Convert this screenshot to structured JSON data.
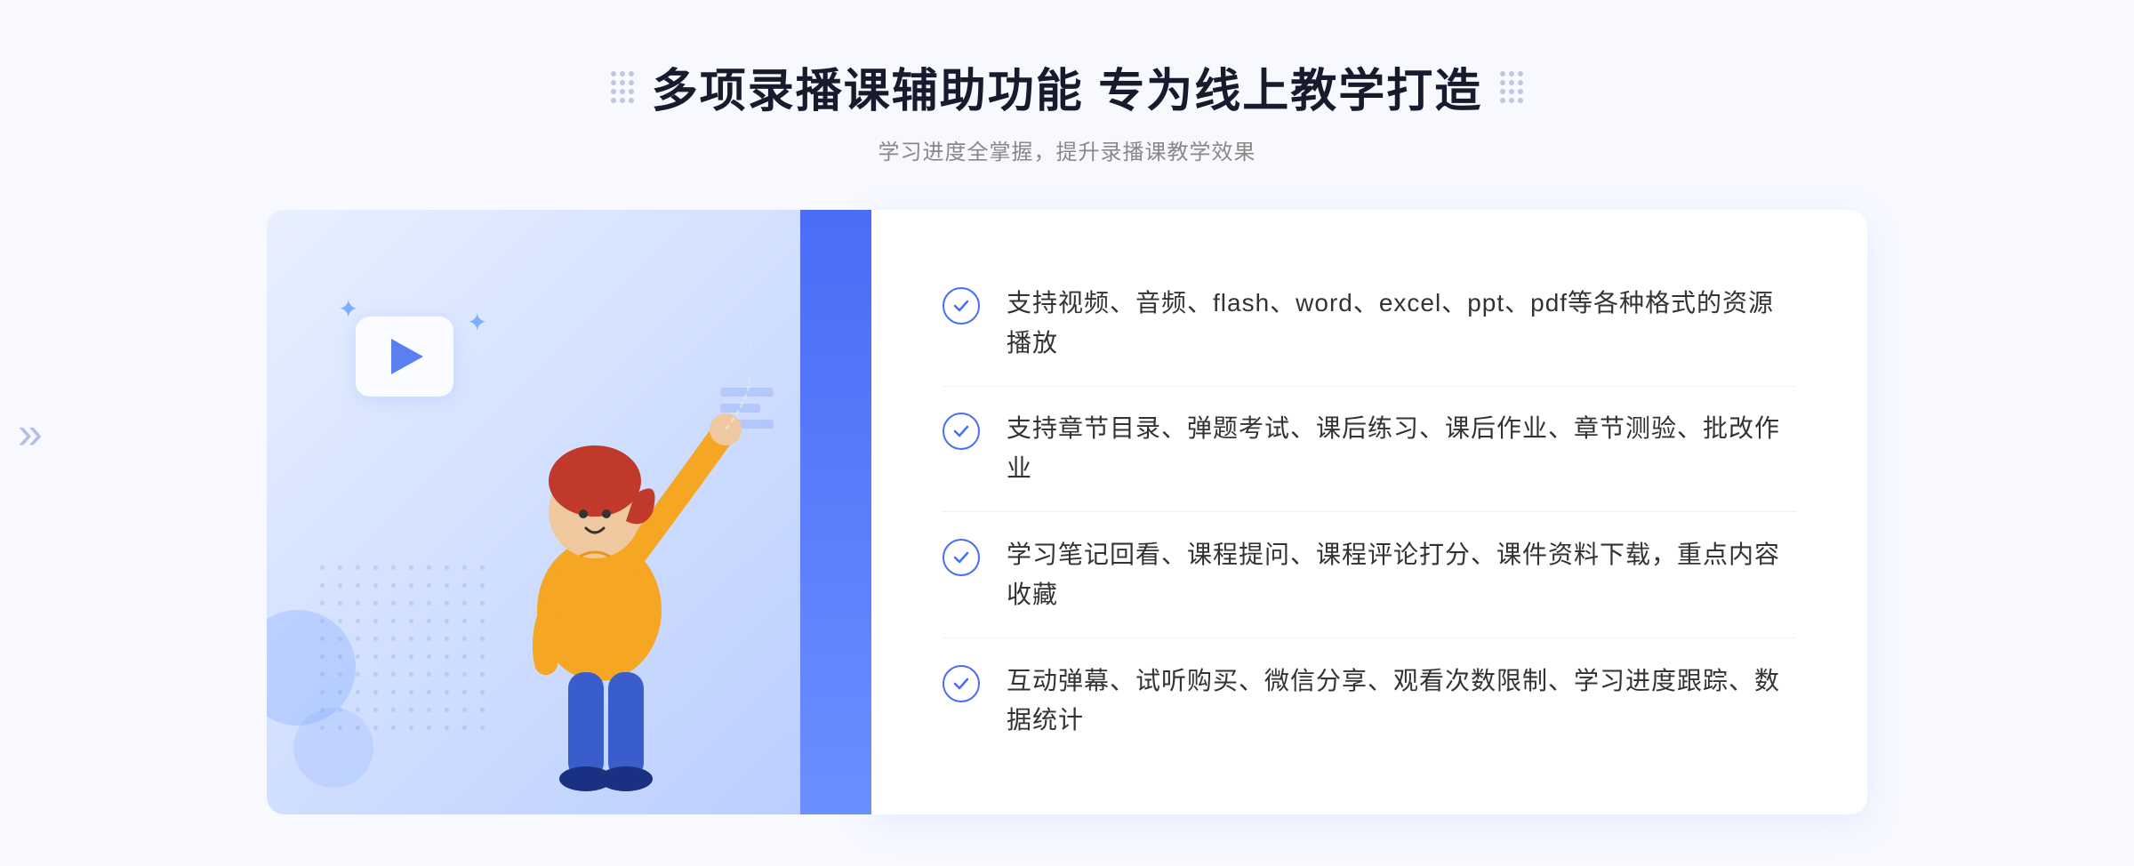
{
  "header": {
    "title": "多项录播课辅助功能 专为线上教学打造",
    "subtitle": "学习进度全掌握，提升录播课教学效果"
  },
  "features": [
    {
      "id": "feature-1",
      "text": "支持视频、音频、flash、word、excel、ppt、pdf等各种格式的资源播放"
    },
    {
      "id": "feature-2",
      "text": "支持章节目录、弹题考试、课后练习、课后作业、章节测验、批改作业"
    },
    {
      "id": "feature-3",
      "text": "学习笔记回看、课程提问、课程评论打分、课件资料下载，重点内容收藏"
    },
    {
      "id": "feature-4",
      "text": "互动弹幕、试听购买、微信分享、观看次数限制、学习进度跟踪、数据统计"
    }
  ],
  "decorations": {
    "dots_left": "❮❮",
    "dots_right": "❯❯",
    "check_symbol": "✓"
  }
}
